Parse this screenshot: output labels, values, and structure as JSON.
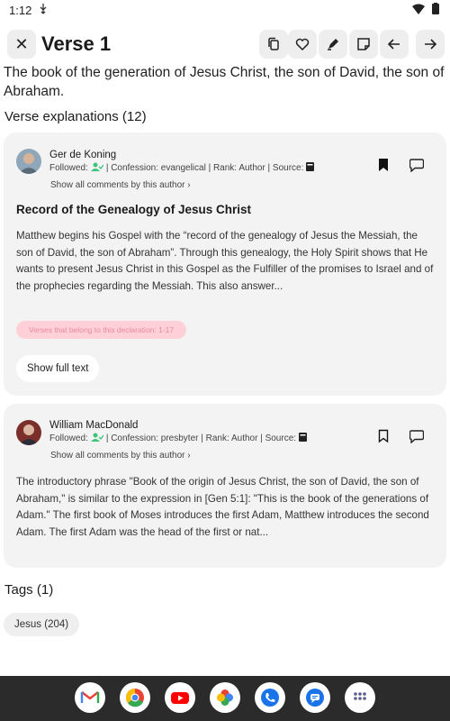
{
  "status_bar": {
    "time": "1:12"
  },
  "header": {
    "title": "Verse 1"
  },
  "verse": {
    "text": "The book of the generation of Jesus Christ, the son of David, the son of Abraham."
  },
  "explanations": {
    "heading": "Verse explanations (12)",
    "cards": [
      {
        "author": "Ger de Koning",
        "followed_label": "Followed:",
        "confession": "| Confession: evangelical | Rank: Author | Source:",
        "show_all": "Show all comments by this author ›",
        "title": "Record of the Genealogy of Jesus Christ",
        "body": "Matthew begins his Gospel with the “record of the genealogy of Jesus the Messiah, the son of David, the son of Abraham”. Through this genealogy, the Holy Spirit shows that He wants to present Jesus Christ in this Gospel as the Fulfiller of the promises to Israel and of the prophecies regarding the Messiah. This also answer...",
        "verses_chip": "Verses that belong to this declaration: 1-17",
        "show_full": "Show full text",
        "bookmarked": true
      },
      {
        "author": "William MacDonald",
        "followed_label": "Followed:",
        "confession": "| Confession: presbyter | Rank: Author | Source:",
        "show_all": "Show all comments by this author ›",
        "body": "The introductory phrase \"Book of the origin of Jesus Christ, the son of David, the son of Abraham,\" is similar to the expression in [Gen 5:1]: \"This is the book of the generations of Adam.\" The first book of Moses introduces the first Adam, Matthew introduces the second Adam. The first Adam was the head of the first or nat...",
        "bookmarked": false
      }
    ]
  },
  "tags": {
    "heading": "Tags (1)",
    "items": [
      {
        "label": "Jesus (204)"
      }
    ]
  },
  "dock": [
    "gmail-icon",
    "chrome-icon",
    "youtube-icon",
    "photos-icon",
    "phone-icon",
    "messages-icon",
    "app-drawer-icon"
  ],
  "colors": {
    "followed_green": "#3cc47c",
    "chip_pink": "#ffd0d8",
    "card_bg": "#f3f3f3"
  }
}
